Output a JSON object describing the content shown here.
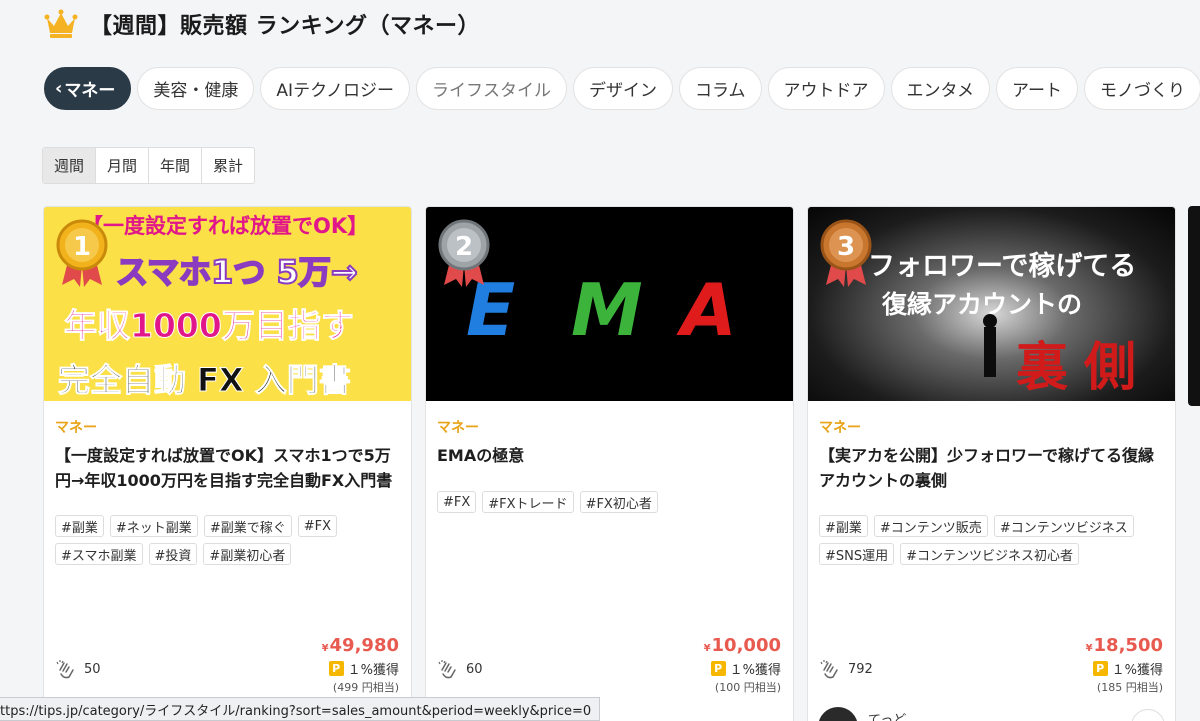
{
  "header": {
    "title": "【週間】販売額 ランキング（マネー）",
    "icon": "crown-icon"
  },
  "category_tabs": [
    {
      "label": "マネー",
      "active": true
    },
    {
      "label": "美容・健康"
    },
    {
      "label": "AIテクノロジー"
    },
    {
      "label": "ライフスタイル",
      "muted": true
    },
    {
      "label": "デザイン"
    },
    {
      "label": "コラム"
    },
    {
      "label": "アウトドア"
    },
    {
      "label": "エンタメ"
    },
    {
      "label": "アート"
    },
    {
      "label": "モノづくり"
    }
  ],
  "tab_prefix": "‹",
  "periods": [
    "週間",
    "月間",
    "年間",
    "累計"
  ],
  "cards": [
    {
      "rank": "1",
      "thumb_lines": [
        "【一度設定すれば放置でOK】",
        "スマホ1つ 5万→",
        "年収1000万目指す",
        "完全自動 FX 入門書"
      ],
      "category": "マネー",
      "title": "【一度設定すれば放置でOK】スマホ1つで5万円→年収1000万円を目指す完全自動FX入門書",
      "tags": [
        "#副業",
        "#ネット副業",
        "#副業で稼ぐ",
        "#FX",
        "#スマホ副業",
        "#投資",
        "#副業初心者"
      ],
      "price_symbol": "¥",
      "price": "49,980",
      "point_badge": "P",
      "point": "１%獲得",
      "point_yen": "(499 円相当)",
      "likes": "50"
    },
    {
      "rank": "2",
      "thumb_lines": [
        "E",
        "M",
        "A"
      ],
      "category": "マネー",
      "title": "EMAの極意",
      "tags": [
        "#FX",
        "#FXトレード",
        "#FX初心者"
      ],
      "price_symbol": "¥",
      "price": "10,000",
      "point_badge": "P",
      "point": "１%獲得",
      "point_yen": "(100 円相当)",
      "likes": "60"
    },
    {
      "rank": "3",
      "thumb_lines": [
        "フォロワーで稼げてる",
        "復縁アカウントの",
        "裏",
        "側"
      ],
      "category": "マネー",
      "title": "【実アカを公開】少フォロワーで稼げてる復縁アカウントの裏側",
      "tags": [
        "#副業",
        "#コンテンツ販売",
        "#コンテンツビジネス",
        "#SNS運用",
        "#コンテンツビジネス初心者"
      ],
      "price_symbol": "¥",
      "price": "18,500",
      "point_badge": "P",
      "point": "１%獲得",
      "point_yen": "(185 円相当)",
      "likes": "792",
      "author": "てっど"
    }
  ],
  "status_url": "ttps://tips.jp/category/ライフスタイル/ranking?sort=sales_amount&period=weekly&price=0",
  "colors": {
    "accent": "#e8a317",
    "price": "#e85a4f",
    "active_tab": "#2b3a47",
    "gold": "#f5b700"
  }
}
